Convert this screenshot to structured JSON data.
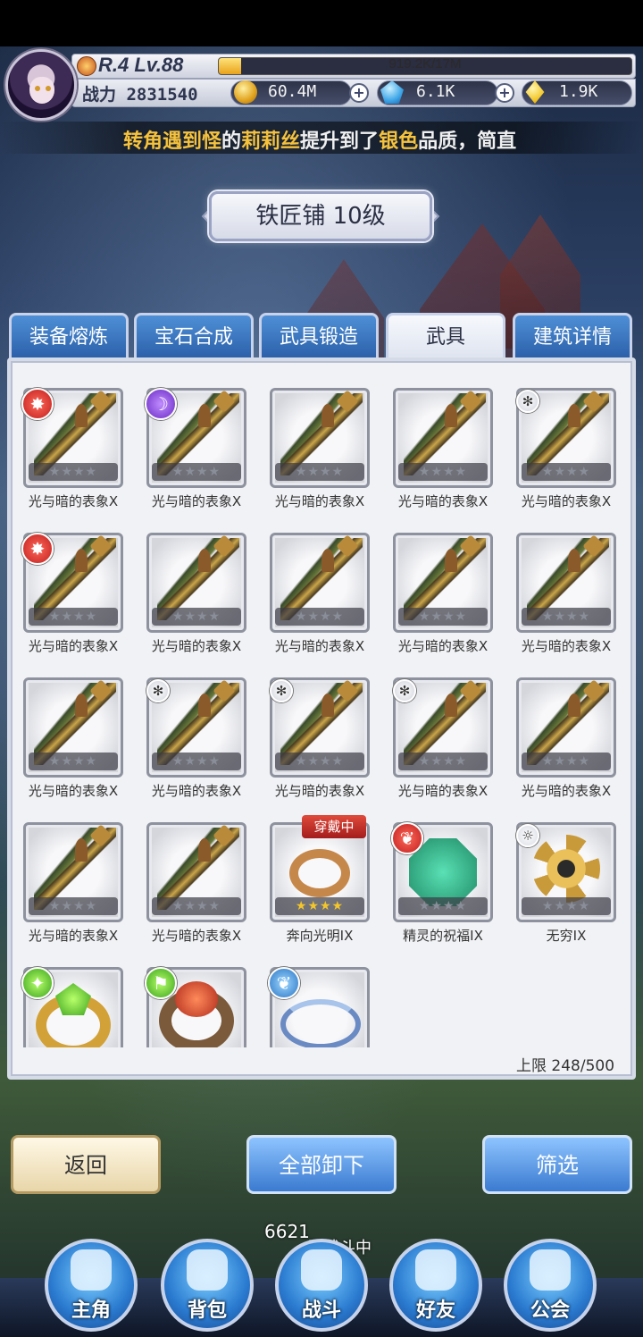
{
  "player": {
    "rank_level": "R.4 Lv.88",
    "exp_text": "919.2K/17M",
    "exp_fraction": 0.054,
    "power_label": "战力",
    "power_value": "2831540"
  },
  "resources": {
    "gold": "60.4M",
    "diamond": "6.1K",
    "crystal": "1.9K"
  },
  "marquee": {
    "part1": "转角遇到怪",
    "part2": "的",
    "part3": "莉莉丝",
    "part4": "提升到了",
    "part5": "银色",
    "part6": "品质，简直"
  },
  "title": "铁匠铺 10级",
  "tabs": [
    {
      "label": "装备熔炼"
    },
    {
      "label": "宝石合成"
    },
    {
      "label": "武具锻造"
    },
    {
      "label": "武具"
    },
    {
      "label": "建筑详情"
    }
  ],
  "items": [
    {
      "name": "光与暗的表象X",
      "element": "fire-icon"
    },
    {
      "name": "光与暗的表象X",
      "element": "dark-icon"
    },
    {
      "name": "光与暗的表象X",
      "element": ""
    },
    {
      "name": "光与暗的表象X",
      "element": ""
    },
    {
      "name": "光与暗的表象X",
      "element": "wind-icon"
    },
    {
      "name": "光与暗的表象X",
      "element": "fire-icon"
    },
    {
      "name": "光与暗的表象X",
      "element": ""
    },
    {
      "name": "光与暗的表象X",
      "element": ""
    },
    {
      "name": "光与暗的表象X",
      "element": ""
    },
    {
      "name": "光与暗的表象X",
      "element": ""
    },
    {
      "name": "光与暗的表象X",
      "element": ""
    },
    {
      "name": "光与暗的表象X",
      "element": "wind-icon"
    },
    {
      "name": "光与暗的表象X",
      "element": "wind-icon"
    },
    {
      "name": "光与暗的表象X",
      "element": "wind-icon"
    },
    {
      "name": "光与暗的表象X",
      "element": ""
    },
    {
      "name": "光与暗的表象X",
      "element": ""
    },
    {
      "name": "光与暗的表象X",
      "element": ""
    },
    {
      "name": "奔向光明IX",
      "element": "",
      "badge": "穿戴中"
    },
    {
      "name": "精灵的祝福IX",
      "element": "wing-icon"
    },
    {
      "name": "无穷IX",
      "element": "sun-icon"
    }
  ],
  "limit": {
    "label": "上限",
    "value": "248/500"
  },
  "buttons": {
    "back": "返回",
    "unequip_all": "全部卸下",
    "filter": "筛选"
  },
  "battle": {
    "floor": "6621",
    "status": "层战斗中"
  },
  "nav": [
    {
      "label": "主角"
    },
    {
      "label": "背包"
    },
    {
      "label": "战斗"
    },
    {
      "label": "好友"
    },
    {
      "label": "公会"
    }
  ],
  "colors": {
    "tab_blue": "#3a74c0",
    "marquee_gold": "#f6c23c",
    "wearing_red": "#c42a22"
  }
}
